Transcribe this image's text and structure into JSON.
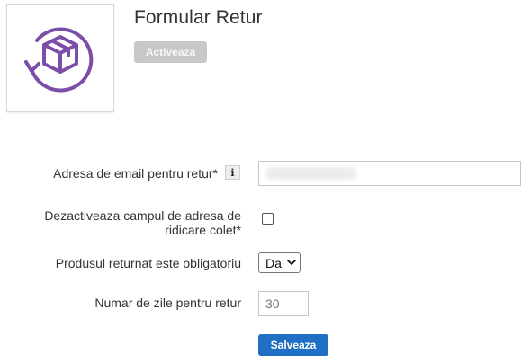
{
  "header": {
    "title": "Formular Retur",
    "activate_label": "Activeaza",
    "logo_icon": "box-return-icon",
    "accent_color": "#7b4ea8"
  },
  "form": {
    "email": {
      "label": "Adresa de email pentru retur*",
      "info_glyph": "i",
      "value": ""
    },
    "disable_pickup": {
      "label_line1": "Dezactiveaza campul de adresa de",
      "label_line2": "ridicare colet*",
      "checked": false
    },
    "product_required": {
      "label": "Produsul returnat este obligatoriu",
      "selected": "Da"
    },
    "return_days": {
      "label": "Numar de zile pentru retur",
      "value": "30"
    },
    "save_label": "Salveaza",
    "save_color": "#1f6fc5"
  }
}
